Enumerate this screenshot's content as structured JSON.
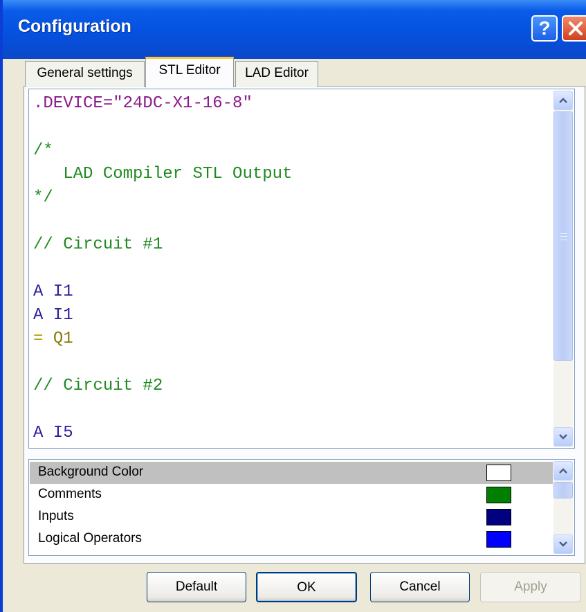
{
  "window": {
    "title": "Configuration",
    "help_button": "?",
    "close_button": "✕"
  },
  "tabs": [
    {
      "label": "General settings",
      "active": false
    },
    {
      "label": "STL Editor",
      "active": true
    },
    {
      "label": "LAD Editor",
      "active": false
    }
  ],
  "editor": {
    "lines": [
      {
        "text": ".DEVICE=\"24DC-X1-16-8\"",
        "kind": "directive"
      },
      {
        "text": "",
        "kind": "blank"
      },
      {
        "text": "/*",
        "kind": "comment"
      },
      {
        "text": "   LAD Compiler STL Output",
        "kind": "comment"
      },
      {
        "text": "*/",
        "kind": "comment"
      },
      {
        "text": "",
        "kind": "blank"
      },
      {
        "text": "// Circuit #1",
        "kind": "comment"
      },
      {
        "text": "",
        "kind": "blank"
      },
      {
        "text": "A I1",
        "kind": "input"
      },
      {
        "text": "A I1",
        "kind": "input"
      },
      {
        "text": "Q1",
        "kind": "assign",
        "prefix": "= "
      },
      {
        "text": "",
        "kind": "blank"
      },
      {
        "text": "// Circuit #2",
        "kind": "comment"
      },
      {
        "text": "",
        "kind": "blank"
      },
      {
        "text": "A I5",
        "kind": "input"
      }
    ],
    "scroll_up_icon": "chevron-up-icon",
    "scroll_down_icon": "chevron-down-icon"
  },
  "colors": {
    "items": [
      {
        "label": "Background Color",
        "color": "#ffffff",
        "selected": true
      },
      {
        "label": "Comments",
        "color": "#007f00",
        "selected": false
      },
      {
        "label": "Inputs",
        "color": "#000080",
        "selected": false
      },
      {
        "label": "Logical Operators",
        "color": "#0000ff",
        "selected": false
      }
    ]
  },
  "buttons": {
    "default": "Default",
    "ok": "OK",
    "cancel": "Cancel",
    "apply": "Apply"
  },
  "scroll_glyphs": {
    "up": "⌃",
    "down": "⌄"
  }
}
